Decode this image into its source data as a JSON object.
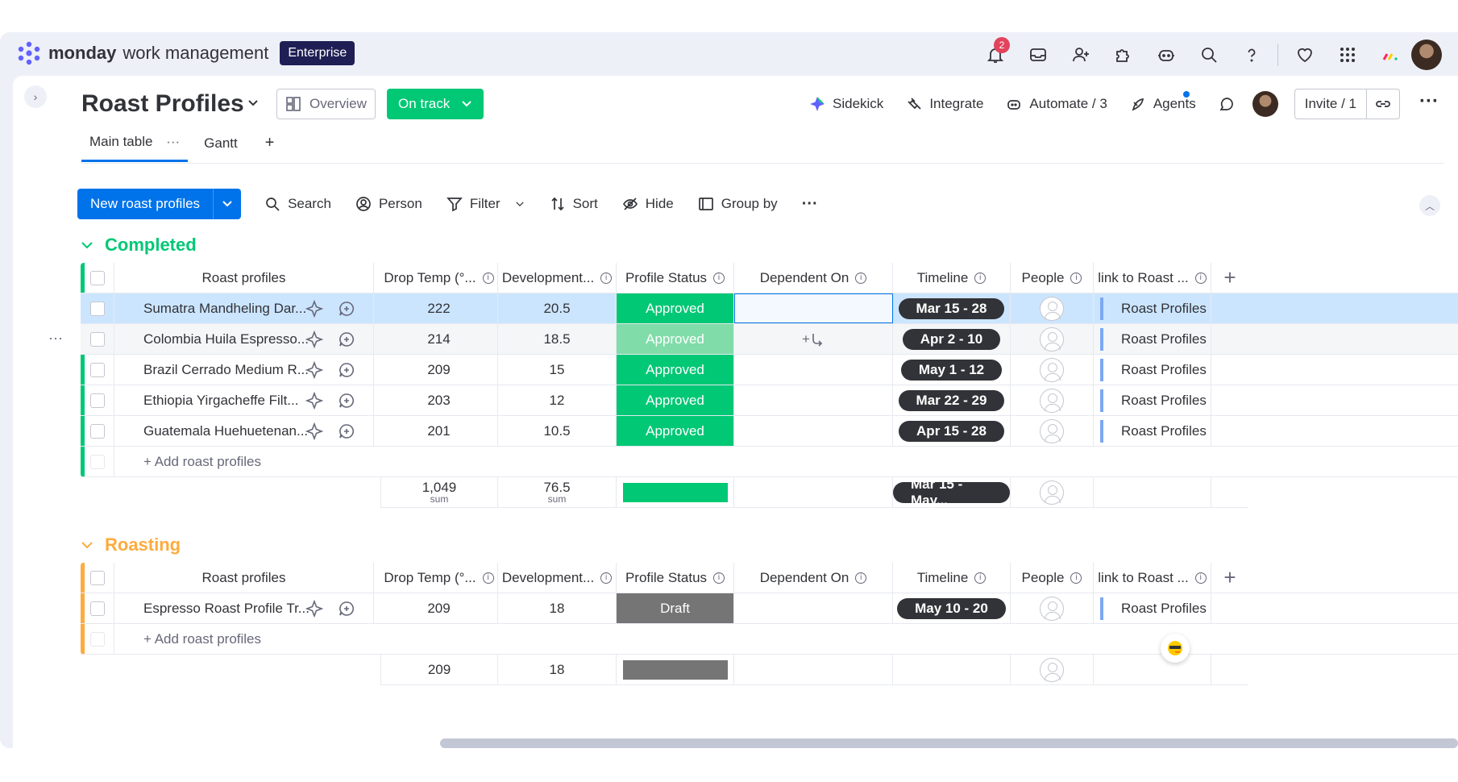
{
  "brand": {
    "bold": "monday",
    "light": "work management",
    "badge": "Enterprise"
  },
  "notifications_count": "2",
  "board": {
    "title": "Roast Profiles",
    "overview_label": "Overview",
    "status_label": "On track",
    "actions": {
      "sidekick": "Sidekick",
      "integrate": "Integrate",
      "automate": "Automate / 3",
      "agents": "Agents",
      "invite": "Invite / 1"
    },
    "tabs": [
      "Main table",
      "Gantt"
    ],
    "tab_more": "···",
    "add_tab": "+"
  },
  "toolbar": {
    "new_item": "New roast profiles",
    "search": "Search",
    "person": "Person",
    "filter": "Filter",
    "sort": "Sort",
    "hide": "Hide",
    "group_by": "Group by",
    "more": "···"
  },
  "columns": [
    "Roast profiles",
    "Drop Temp (°...",
    "Development...",
    "Profile Status",
    "Dependent On",
    "Timeline",
    "People",
    "link to Roast ..."
  ],
  "row_more": "···",
  "groups": [
    {
      "title": "Completed",
      "color": "#00c875",
      "rows": [
        {
          "name": "Sumatra Mandheling Dar...",
          "drop_temp": "222",
          "development": "20.5",
          "status": "Approved",
          "timeline": "Mar 15 - 28",
          "link": "Roast Profiles"
        },
        {
          "name": "Colombia Huila Espresso...",
          "drop_temp": "214",
          "development": "18.5",
          "status": "Approved",
          "timeline": "Apr 2 - 10",
          "link": "Roast Profiles"
        },
        {
          "name": "Brazil Cerrado Medium R...",
          "drop_temp": "209",
          "development": "15",
          "status": "Approved",
          "timeline": "May 1 - 12",
          "link": "Roast Profiles"
        },
        {
          "name": "Ethiopia Yirgacheffe Filt...",
          "drop_temp": "203",
          "development": "12",
          "status": "Approved",
          "timeline": "Mar 22 - 29",
          "link": "Roast Profiles"
        },
        {
          "name": "Guatemala Huehuetenan...",
          "drop_temp": "201",
          "development": "10.5",
          "status": "Approved",
          "timeline": "Apr 15 - 28",
          "link": "Roast Profiles"
        }
      ],
      "add_label": "+ Add roast profiles",
      "summary": {
        "drop_temp": "1,049",
        "development": "76.5",
        "sum_label": "sum",
        "timeline": "Mar 15 - May..."
      }
    },
    {
      "title": "Roasting",
      "color": "#fdab3d",
      "rows": [
        {
          "name": "Espresso Roast Profile Tr...",
          "drop_temp": "209",
          "development": "18",
          "status": "Draft",
          "timeline": "May 10 - 20",
          "link": "Roast Profiles"
        }
      ],
      "add_label": "+ Add roast profiles",
      "summary": {
        "drop_temp": "209",
        "development": "18"
      }
    }
  ],
  "dependency_hint": "+",
  "colors": {
    "approved": "#00c875",
    "approved_hover": "#80dca9",
    "draft": "#757575",
    "selected_row": "#cce5ff",
    "accent": "#0073ea"
  }
}
